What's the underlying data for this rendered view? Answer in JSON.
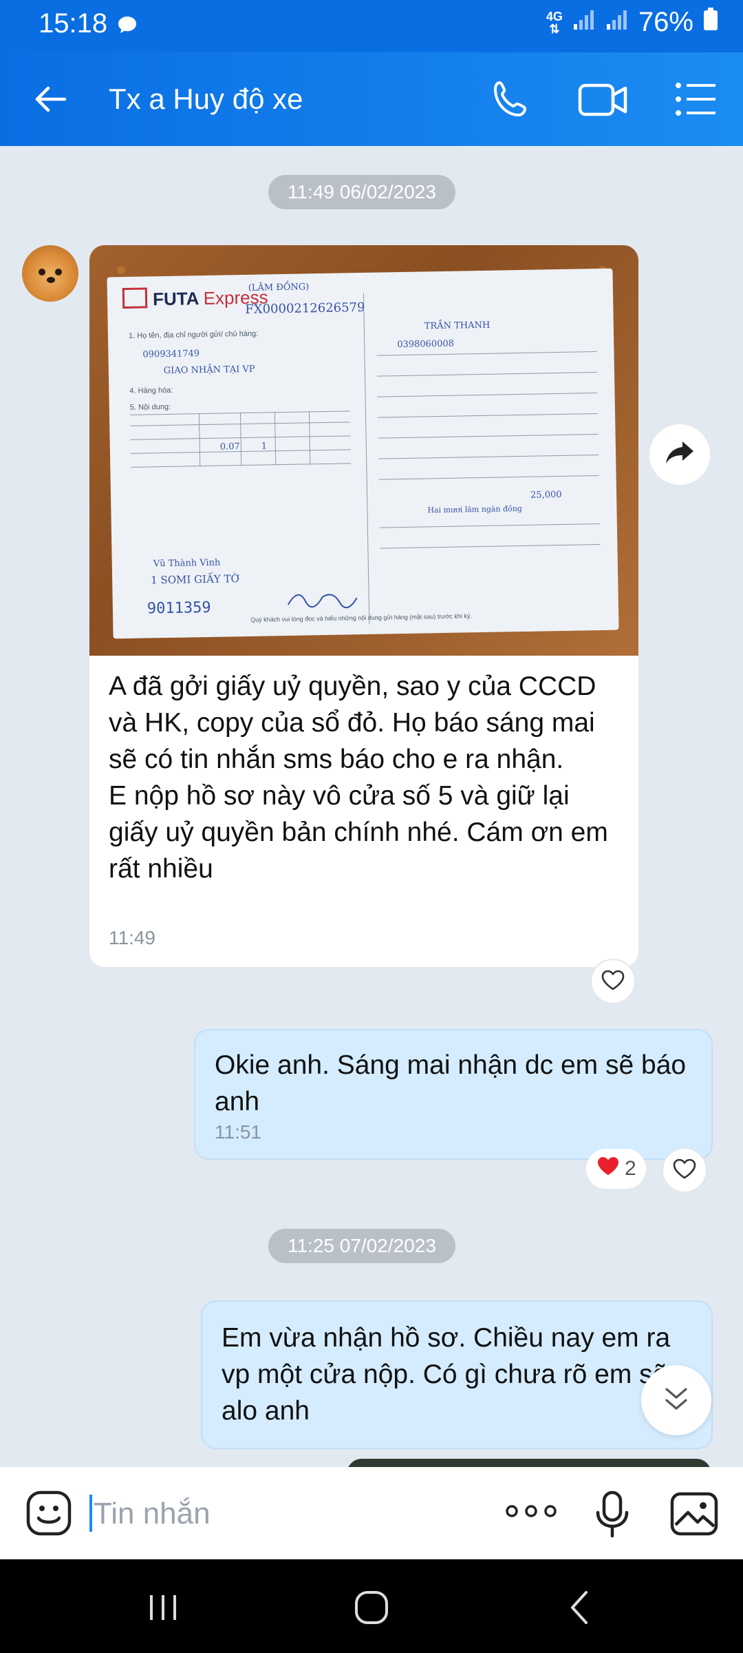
{
  "status_bar": {
    "time": "15:18",
    "network": "4G",
    "battery": "76%"
  },
  "header": {
    "title": "Tx a Huy độ xe"
  },
  "messages": [
    {
      "date": "11:49 06/02/2023",
      "incoming": {
        "photo_caption": {
          "brand": "FUTA",
          "brand_suffix": "Express",
          "region": "(LÂM ĐỒNG)",
          "code": "FX0000212626579",
          "serial": "9011359",
          "note": "1 SOMI GIẤY TỜ",
          "sender": "Vũ Thành Vinh",
          "receiver": "TRẦN THANH",
          "phone": "0909341749",
          "receiver_phone": "0398060008",
          "service": "GIAO NHẬN TẠI VP",
          "weight": "0.07",
          "qty": "1",
          "amount": "25,000",
          "amount_words": "Hai mươi lăm ngàn đồng",
          "footer": "Quý khách vui lòng đọc và hiểu những nội dung gửi hàng (mặt sau) trước khi ký."
        },
        "text": "A đã gởi giấy uỷ quyền, sao y của CCCD và HK, copy của sổ đỏ. Họ báo sáng mai sẽ có tin nhắn sms báo cho e ra nhận.\nE nộp hồ sơ này vô cửa số 5 và giữ lại giấy uỷ quyền bản chính nhé. Cám ơn em rất nhiều",
        "time": "11:49"
      },
      "outgoing": {
        "text": "Okie anh. Sáng mai nhận dc em sẽ báo anh",
        "time": "11:51",
        "reaction_count": "2"
      }
    },
    {
      "date": "11:25 07/02/2023",
      "outgoing": {
        "text": "Em vừa nhận hồ sơ. Chiều nay em ra vp một cửa nộp. Có gì chưa rõ em sẽ alo anh"
      }
    }
  ],
  "input": {
    "placeholder": "Tin nhắn"
  },
  "icons": {
    "back": "arrow-left-icon",
    "call": "phone-icon",
    "video": "video-camera-icon",
    "menu": "list-menu-icon",
    "share": "share-arrow-icon",
    "like": "heart-outline-icon",
    "reaction": "heart-filled-icon",
    "scroll": "chevron-double-down-icon",
    "sticker": "sticker-face-icon",
    "more": "more-dots-icon",
    "mic": "microphone-icon",
    "image": "image-icon"
  },
  "colors": {
    "header": "#0a6ee3",
    "outgoing_bubble": "#d4ecfe",
    "chat_bg": "#e2e9f1",
    "reaction": "#e8202c"
  }
}
